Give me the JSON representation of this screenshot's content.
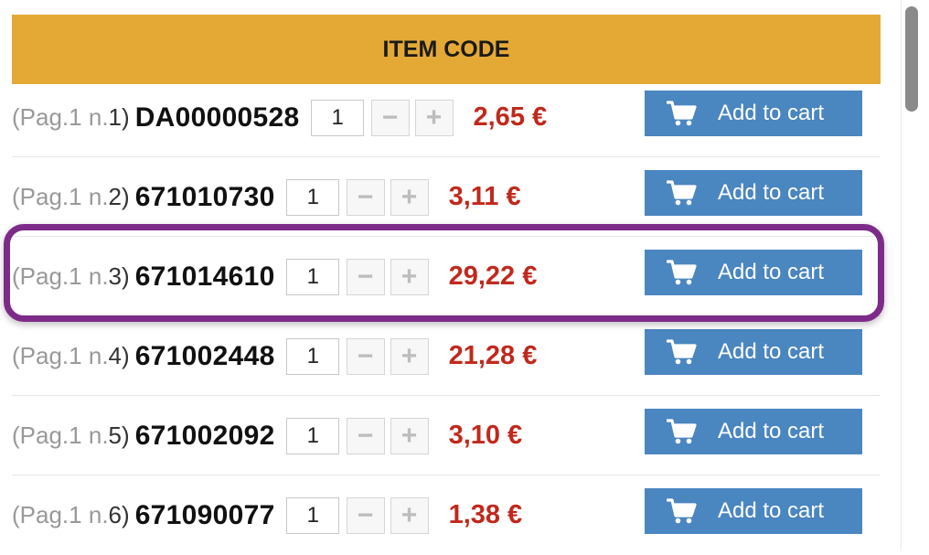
{
  "header": {
    "title": "ITEM CODE"
  },
  "rows": [
    {
      "open": "(",
      "pag": "Pag.1",
      "n_label": "n.",
      "n_value": "1",
      "close": ")",
      "code": "DA00000528",
      "qty": "1",
      "minus": "−",
      "plus": "+",
      "price": "2,65 €",
      "cart_label": "Add to cart"
    },
    {
      "open": "(",
      "pag": "Pag.1",
      "n_label": "n.",
      "n_value": "2",
      "close": ")",
      "code": "671010730",
      "qty": "1",
      "minus": "−",
      "plus": "+",
      "price": "3,11 €",
      "cart_label": "Add to cart"
    },
    {
      "open": "(",
      "pag": "Pag.1",
      "n_label": "n.",
      "n_value": "3",
      "close": ")",
      "code": "671014610",
      "qty": "1",
      "minus": "−",
      "plus": "+",
      "price": "29,22 €",
      "cart_label": "Add to cart"
    },
    {
      "open": "(",
      "pag": "Pag.1",
      "n_label": "n.",
      "n_value": "4",
      "close": ")",
      "code": "671002448",
      "qty": "1",
      "minus": "−",
      "plus": "+",
      "price": "21,28 €",
      "cart_label": "Add to cart"
    },
    {
      "open": "(",
      "pag": "Pag.1",
      "n_label": "n.",
      "n_value": "5",
      "close": ")",
      "code": "671002092",
      "qty": "1",
      "minus": "−",
      "plus": "+",
      "price": "3,10 €",
      "cart_label": "Add to cart"
    },
    {
      "open": "(",
      "pag": "Pag.1",
      "n_label": "n.",
      "n_value": "6",
      "close": ")",
      "code": "671090077",
      "qty": "1",
      "minus": "−",
      "plus": "+",
      "price": "1,38 €",
      "cart_label": "Add to cart"
    }
  ],
  "highlight": {
    "row": 3,
    "color": "#7d2b89"
  },
  "colors": {
    "header_bg": "#e4a935",
    "button_bg": "#4a86c0",
    "price": "#c0291c"
  },
  "icons": {
    "cart": "cart-icon"
  }
}
